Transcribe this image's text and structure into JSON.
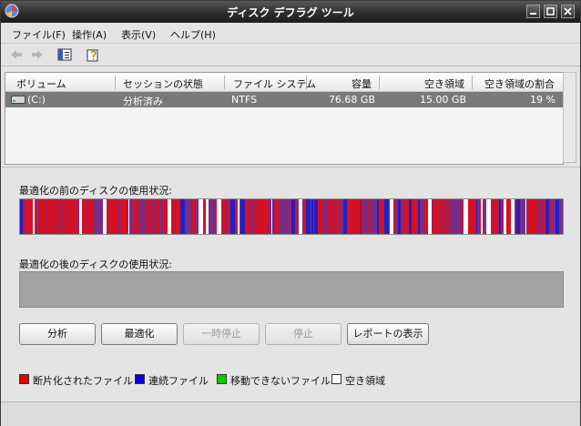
{
  "window": {
    "title": "ディスク デフラグ ツール"
  },
  "menu": [
    "ファイル(F)",
    "操作(A)",
    "表示(V)",
    "ヘルプ(H)"
  ],
  "columns": [
    "ボリューム",
    "セッションの状態",
    "ファイル システム",
    "容量",
    "空き領域",
    "空き領域の割合"
  ],
  "volumes": [
    {
      "volume": "(C:)",
      "status": "分析済み",
      "fs": "NTFS",
      "capacity": "76.68 GB",
      "free": "15.00 GB",
      "free_pct": "19 %"
    }
  ],
  "before_label": "最適化の前のディスクの使用状況:",
  "after_label": "最適化の後のディスクの使用状況:",
  "buttons": {
    "analyze": "分析",
    "defrag": "最適化",
    "pause": "一時停止",
    "stop": "停止",
    "report": "レポートの表示"
  },
  "legend": [
    {
      "label": "断片化されたファイル",
      "color": "#e00000"
    },
    {
      "label": "連続ファイル",
      "color": "#0000e0"
    },
    {
      "label": "移動できないファイル",
      "color": "#00d000"
    },
    {
      "label": "空き領域",
      "color": "#ffffff"
    }
  ],
  "colors": {
    "fragmented": "#d81020",
    "contiguous": "#2020c8",
    "base": "#7a2c86",
    "free": "#ffffff"
  }
}
